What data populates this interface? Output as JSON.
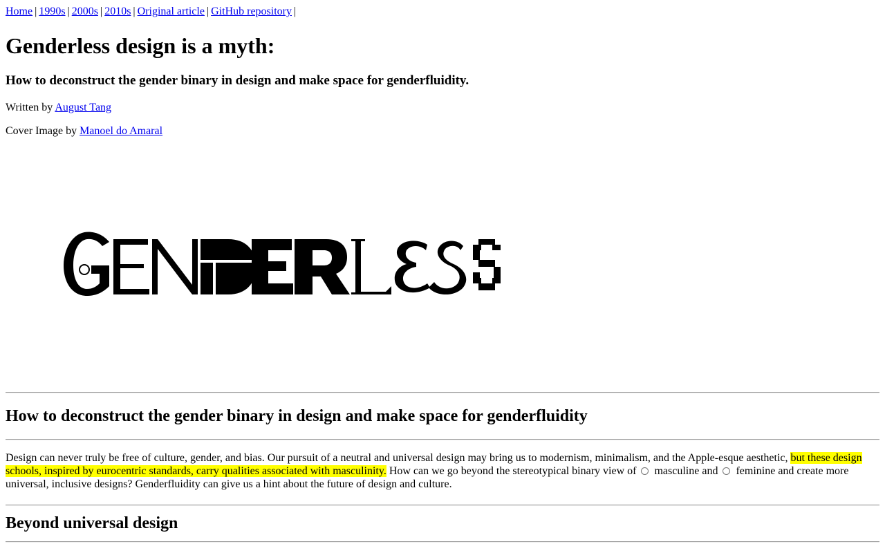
{
  "nav": {
    "links": [
      "Home",
      "1990s",
      "2000s",
      "2010s",
      "Original article",
      "GitHub repository"
    ],
    "separator": "|"
  },
  "article": {
    "title": "Genderless design is a myth:",
    "subtitle": "How to deconstruct the gender binary in design and make space for genderfluidity.",
    "written_by_label": "Written by",
    "author": "August Tang",
    "cover_label": "Cover Image by",
    "cover_author": "Manoel do Amaral",
    "cover_wordmark_letters": [
      "G",
      "E",
      "N",
      "D",
      "E",
      "R",
      "L",
      "E",
      "S",
      "S"
    ],
    "section_heading": "How to deconstruct the gender binary in design and make space for genderfluidity",
    "intro_part1": "Design can never truly be free of culture, gender, and bias. Our pursuit of a neutral and universal design may bring us to modernism, minimalism, and the Apple-esque aesthetic, ",
    "intro_highlight": "but these design schools, inspired by eurocentric standards, carry qualities associated with masculinity.",
    "intro_part2": " How can we go beyond the stereotypical binary view of",
    "radio_masculine_label": "masculine and",
    "radio_feminine_label": "feminine and create more universal, inclusive designs? Genderfluidity can give us a hint about the future of design and culture.",
    "section2_heading": "Beyond universal design"
  }
}
